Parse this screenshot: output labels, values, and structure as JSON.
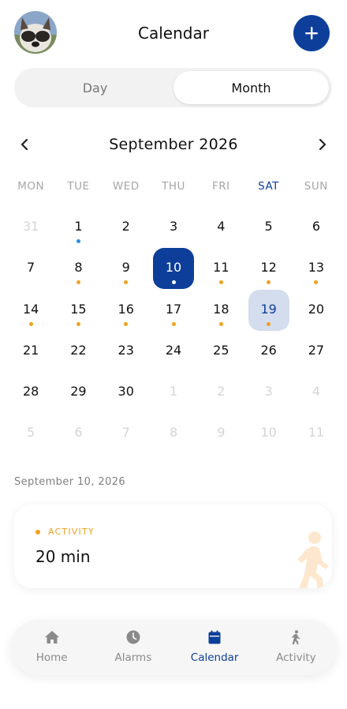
{
  "header": {
    "title": "Calendar",
    "avatar_icon": "dog-avatar",
    "add_icon": "plus-icon"
  },
  "segment": {
    "day_label": "Day",
    "month_label": "Month",
    "selected": "Month"
  },
  "month_nav": {
    "label": "September 2026",
    "prev_icon": "chevron-left-icon",
    "next_icon": "chevron-right-icon"
  },
  "weekdays": [
    "MON",
    "TUE",
    "WED",
    "THU",
    "FRI",
    "SAT",
    "SUN"
  ],
  "calendar": {
    "days": [
      {
        "n": "31",
        "m": true,
        "dot": ""
      },
      {
        "n": "1",
        "m": false,
        "dot": "blue"
      },
      {
        "n": "2",
        "m": false,
        "dot": ""
      },
      {
        "n": "3",
        "m": false,
        "dot": ""
      },
      {
        "n": "4",
        "m": false,
        "dot": ""
      },
      {
        "n": "5",
        "m": false,
        "dot": ""
      },
      {
        "n": "6",
        "m": false,
        "dot": ""
      },
      {
        "n": "7",
        "m": false,
        "dot": ""
      },
      {
        "n": "8",
        "m": false,
        "dot": "orange"
      },
      {
        "n": "9",
        "m": false,
        "dot": "orange"
      },
      {
        "n": "10",
        "m": false,
        "dot": "white",
        "state": "today"
      },
      {
        "n": "11",
        "m": false,
        "dot": "orange"
      },
      {
        "n": "12",
        "m": false,
        "dot": "orange"
      },
      {
        "n": "13",
        "m": false,
        "dot": "orange"
      },
      {
        "n": "14",
        "m": false,
        "dot": "orange"
      },
      {
        "n": "15",
        "m": false,
        "dot": "orange"
      },
      {
        "n": "16",
        "m": false,
        "dot": "orange"
      },
      {
        "n": "17",
        "m": false,
        "dot": "orange"
      },
      {
        "n": "18",
        "m": false,
        "dot": "orange"
      },
      {
        "n": "19",
        "m": false,
        "dot": "orange",
        "state": "selected"
      },
      {
        "n": "20",
        "m": false,
        "dot": ""
      },
      {
        "n": "21",
        "m": false,
        "dot": ""
      },
      {
        "n": "22",
        "m": false,
        "dot": ""
      },
      {
        "n": "23",
        "m": false,
        "dot": ""
      },
      {
        "n": "24",
        "m": false,
        "dot": ""
      },
      {
        "n": "25",
        "m": false,
        "dot": ""
      },
      {
        "n": "26",
        "m": false,
        "dot": ""
      },
      {
        "n": "27",
        "m": false,
        "dot": ""
      },
      {
        "n": "28",
        "m": false,
        "dot": ""
      },
      {
        "n": "29",
        "m": false,
        "dot": ""
      },
      {
        "n": "30",
        "m": false,
        "dot": ""
      },
      {
        "n": "1",
        "m": true,
        "dot": ""
      },
      {
        "n": "2",
        "m": true,
        "dot": ""
      },
      {
        "n": "3",
        "m": true,
        "dot": ""
      },
      {
        "n": "4",
        "m": true,
        "dot": ""
      },
      {
        "n": "5",
        "m": true,
        "dot": ""
      },
      {
        "n": "6",
        "m": true,
        "dot": ""
      },
      {
        "n": "7",
        "m": true,
        "dot": ""
      },
      {
        "n": "8",
        "m": true,
        "dot": ""
      },
      {
        "n": "9",
        "m": true,
        "dot": ""
      },
      {
        "n": "10",
        "m": true,
        "dot": ""
      },
      {
        "n": "11",
        "m": true,
        "dot": ""
      }
    ]
  },
  "selected_date_label": "September 10, 2026",
  "activity_card": {
    "tag": "ACTIVITY",
    "value": "20 min",
    "icon": "walking-person-icon"
  },
  "bottom_nav": {
    "items": [
      {
        "label": "Home",
        "icon": "home-icon",
        "active": false
      },
      {
        "label": "Alarms",
        "icon": "clock-icon",
        "active": false
      },
      {
        "label": "Calendar",
        "icon": "calendar-icon",
        "active": true
      },
      {
        "label": "Activity",
        "icon": "walking-icon",
        "active": false
      }
    ]
  },
  "colors": {
    "primary": "#0d3f9a",
    "selected_bg": "#d3dded",
    "activity_orange": "#f0a01f",
    "event_blue": "#2a8fe5"
  }
}
